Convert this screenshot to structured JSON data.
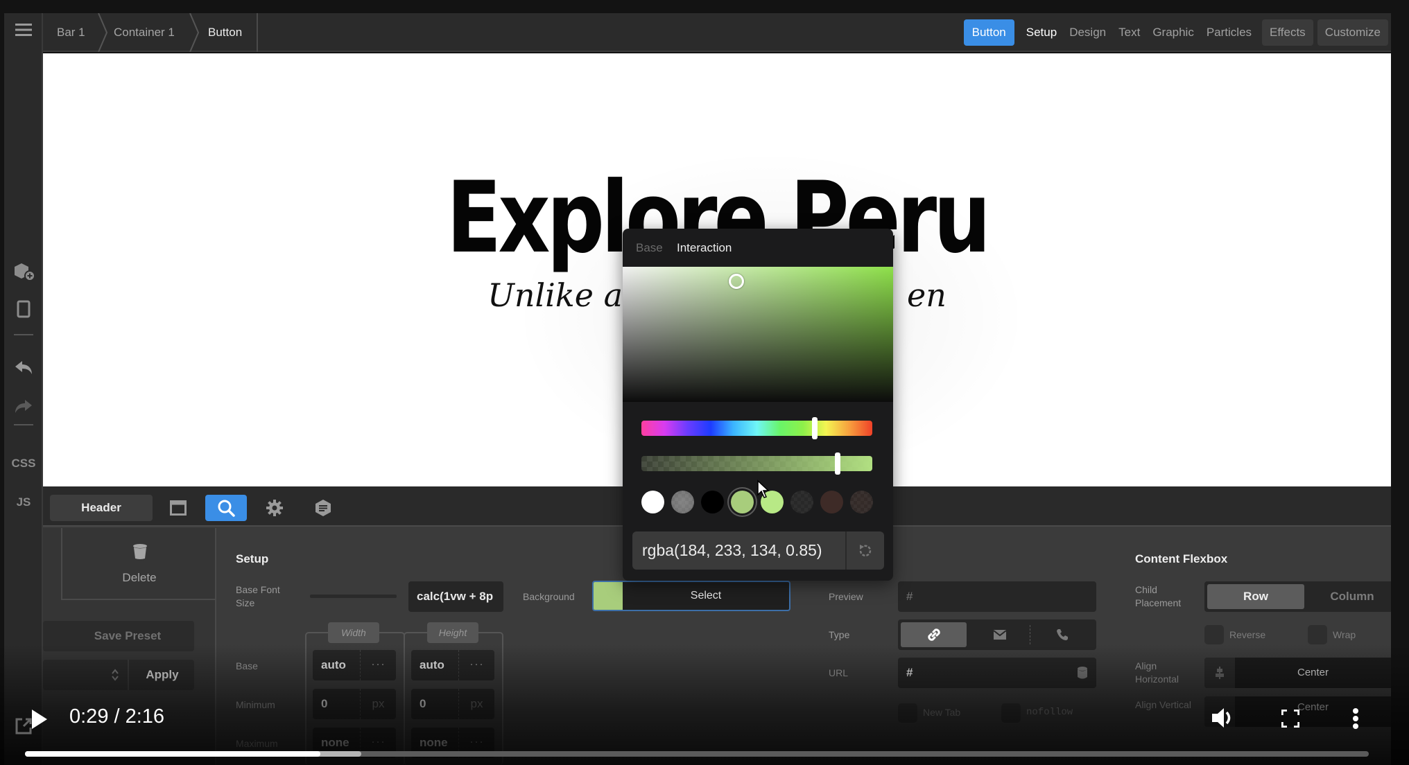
{
  "breadcrumb": [
    "Bar 1",
    "Container 1",
    "Button"
  ],
  "top_tabs": {
    "element_badge": "Button",
    "items": [
      "Setup",
      "Design",
      "Text",
      "Graphic",
      "Particles"
    ],
    "active": "Setup",
    "effects": "Effects",
    "customize": "Customize"
  },
  "rail": {
    "icons": [
      "menu-icon",
      "add-block-icon",
      "device-preview-icon",
      "undo-icon",
      "redo-icon"
    ],
    "css_label": "CSS",
    "js_label": "JS"
  },
  "canvas": {
    "title": "Explore Peru",
    "subtitle_left": "Unlike a",
    "subtitle_right": "en"
  },
  "panel": {
    "header_button": "Header",
    "delete_label": "Delete",
    "save_preset": "Save Preset",
    "apply": "Apply",
    "setup": {
      "title": "Setup",
      "base_font_size_label": "Base Font Size",
      "base_font_size_value": "calc(1vw + 8p",
      "width_tag": "Width",
      "height_tag": "Height",
      "rows": [
        {
          "label": "Base",
          "width": "auto",
          "height": "auto",
          "suffix": "···"
        },
        {
          "label": "Minimum",
          "width": "0",
          "height": "0",
          "suffix": "px"
        },
        {
          "label": "Maximum",
          "width": "none",
          "height": "none",
          "suffix": "···"
        }
      ],
      "background_label": "Background",
      "background_select": "Select",
      "background_color": "#a8cd7c"
    },
    "link": {
      "preview_label": "Preview",
      "preview_value": "#",
      "type_label": "Type",
      "type_options": [
        "link-icon",
        "email-icon",
        "phone-icon"
      ],
      "type_selected": "link-icon",
      "url_label": "URL",
      "url_value": "#",
      "new_tab": "New Tab",
      "nofollow": "nofollow"
    },
    "flexbox": {
      "title": "Content Flexbox",
      "child_placement_label": "Child Placement",
      "options": [
        "Row",
        "Column"
      ],
      "selected": "Row",
      "reverse": "Reverse",
      "wrap": "Wrap",
      "align_h_label": "Align Horizontal",
      "align_h_value": "Center",
      "align_v_label": "Align Vertical",
      "align_v_value": "Center"
    }
  },
  "color_picker": {
    "tabs": [
      "Base",
      "Interaction"
    ],
    "active_tab": "Interaction",
    "value": "rgba(184, 233, 134, 0.85)",
    "hue_position": 0.75,
    "alpha": 0.85,
    "swatches": [
      {
        "name": "white",
        "color": "#ffffff"
      },
      {
        "name": "gray-transparent",
        "color": "#9a9a9a"
      },
      {
        "name": "black",
        "color": "#000000"
      },
      {
        "name": "green-selected",
        "color": "#a8cd7c",
        "selected": true
      },
      {
        "name": "light-green",
        "color": "#b8e986"
      },
      {
        "name": "transparent-dark",
        "color": "#2a2a2a"
      },
      {
        "name": "brown",
        "color": "#3e2b27"
      },
      {
        "name": "brown-transparent",
        "color": "#3a2e2b"
      }
    ]
  },
  "video": {
    "time": "0:29 / 2:16",
    "played_fraction": 0.22,
    "buffered_fraction": 0.25
  },
  "colors": {
    "accent": "#3a8ee6",
    "panel_bg": "#3b3b3b",
    "toolbar_bg": "#2b2b2b"
  }
}
